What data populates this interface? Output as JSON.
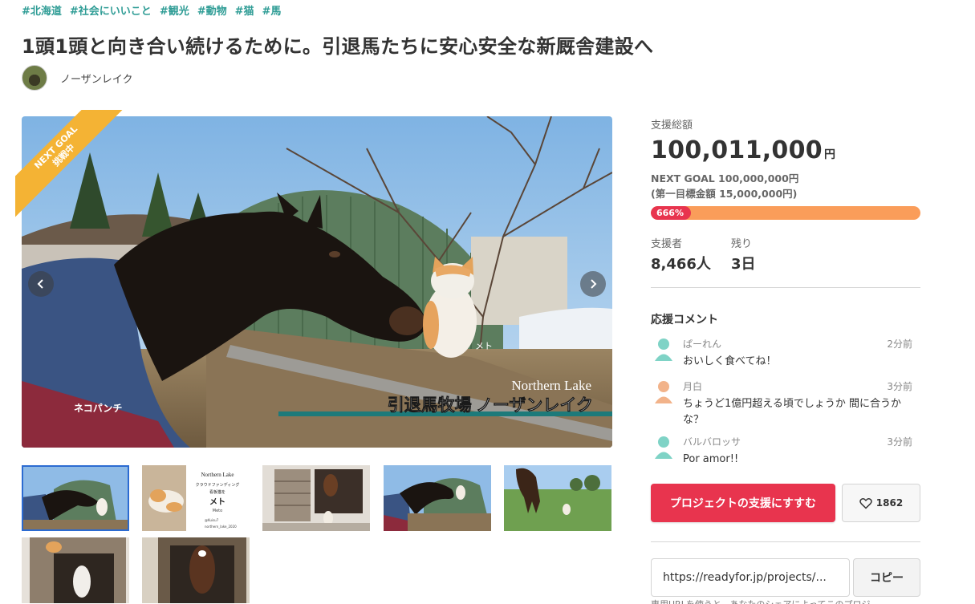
{
  "tags": [
    "#北海道",
    "#社会にいいこと",
    "#観光",
    "#動物",
    "#猫",
    "#馬"
  ],
  "title": "1頭1頭と向き合い続けるために。引退馬たちに安心安全な新厩舎建設へ",
  "owner": {
    "name": "ノーザンレイク"
  },
  "main_image": {
    "ribbon_line1": "NEXT GOAL",
    "ribbon_line2": "挑戦中",
    "caption_horse": "ネコパンチ",
    "caption_cat": "メト",
    "caption_en": "Northern Lake",
    "caption_jp": "引退馬牧場 ノーザンレイク"
  },
  "thumbnail_card": {
    "title": "Northern Lake",
    "line1": "クラウドファンディング",
    "line2": "看板猫を",
    "name": "メト",
    "name_en": "Meto",
    "sns1": "@Kuisu7",
    "sns2": "northern_lake_2020"
  },
  "funding": {
    "total_label": "支援総額",
    "amount": "100,011,000",
    "currency": "円",
    "next_goal": "NEXT GOAL 100,000,000円",
    "first_goal": "(第一目標金額 15,000,000円)",
    "progress_label": "666%",
    "progress_fraction": 0.148,
    "supporters_label": "支援者",
    "supporters_value": "8,466人",
    "remaining_label": "残り",
    "remaining_value": "3日"
  },
  "comments": {
    "title": "応援コメント",
    "items": [
      {
        "name": "ぱーれん",
        "time": "2分前",
        "text": "おいしく食べてね！",
        "avatar_color": "#7fd3c6"
      },
      {
        "name": "月白",
        "time": "3分前",
        "text": "ちょうど1億円超える頃でしょうか 間に合うかな？",
        "avatar_color": "#f2b38a"
      },
      {
        "name": "バルバロッサ",
        "time": "3分前",
        "text": "Por amor!!",
        "avatar_color": "#7fd3c6"
      }
    ]
  },
  "actions": {
    "support_label": "プロジェクトの支援にすすむ",
    "favorite_count": "1862"
  },
  "share": {
    "url_value": "https://readyfor.jp/projects/...",
    "copy_label": "コピー",
    "note": "専用URLを使うと、あなたのシェアによってこのプロジ"
  },
  "colors": {
    "tag": "#2e9c95",
    "accent_red": "#e8344e",
    "progress_bg": "#fa9d5a",
    "ribbon": "#f4b334"
  },
  "icons": [
    "chevron-left-icon",
    "chevron-right-icon",
    "heart-icon",
    "user-avatar-icon"
  ]
}
